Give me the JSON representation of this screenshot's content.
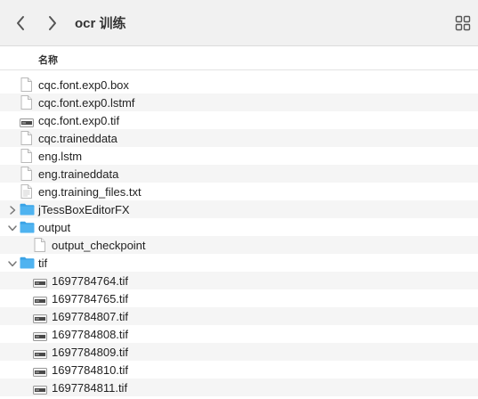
{
  "window": {
    "title": "ocr 训练"
  },
  "header": {
    "name_column": "名称"
  },
  "files": [
    {
      "name": "cqc.font.exp0.box",
      "kind": "doc",
      "depth": 0
    },
    {
      "name": "cqc.font.exp0.lstmf",
      "kind": "doc",
      "depth": 0
    },
    {
      "name": "cqc.font.exp0.tif",
      "kind": "tif",
      "depth": 0
    },
    {
      "name": "cqc.traineddata",
      "kind": "doc",
      "depth": 0
    },
    {
      "name": "eng.lstm",
      "kind": "doc",
      "depth": 0
    },
    {
      "name": "eng.traineddata",
      "kind": "doc",
      "depth": 0
    },
    {
      "name": "eng.training_files.txt",
      "kind": "txt",
      "depth": 0
    },
    {
      "name": "jTessBoxEditorFX",
      "kind": "folder",
      "depth": 0,
      "expanded": false
    },
    {
      "name": "output",
      "kind": "folder",
      "depth": 0,
      "expanded": true
    },
    {
      "name": "output_checkpoint",
      "kind": "doc",
      "depth": 1
    },
    {
      "name": "tif",
      "kind": "folder",
      "depth": 0,
      "expanded": true
    },
    {
      "name": "1697784764.tif",
      "kind": "tif",
      "depth": 1
    },
    {
      "name": "1697784765.tif",
      "kind": "tif",
      "depth": 1
    },
    {
      "name": "1697784807.tif",
      "kind": "tif",
      "depth": 1
    },
    {
      "name": "1697784808.tif",
      "kind": "tif",
      "depth": 1
    },
    {
      "name": "1697784809.tif",
      "kind": "tif",
      "depth": 1
    },
    {
      "name": "1697784810.tif",
      "kind": "tif",
      "depth": 1
    },
    {
      "name": "1697784811.tif",
      "kind": "tif",
      "depth": 1
    }
  ],
  "colors": {
    "folder": "#4fb3f0",
    "folder_tab": "#3aa3e6",
    "toolbar_bg": "#f1f1f1",
    "alt_row": "#f5f5f5"
  }
}
